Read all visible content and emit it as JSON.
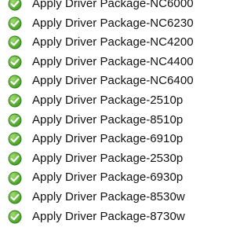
{
  "colors": {
    "check_fill_light": "#9fdc6d",
    "check_fill_dark": "#3f9a22",
    "check_border": "#2e7d17",
    "text": "#111111",
    "background": "#ffffff"
  },
  "task_list": {
    "icon": "check-circle-icon",
    "items": [
      {
        "label": "Apply Driver Package-NC6000",
        "status": "complete"
      },
      {
        "label": "Apply Driver Package-NC6230",
        "status": "complete"
      },
      {
        "label": "Apply Driver Package-NC4200",
        "status": "complete"
      },
      {
        "label": "Apply Driver Package-NC4400",
        "status": "complete"
      },
      {
        "label": "Apply Driver Package-NC6400",
        "status": "complete"
      },
      {
        "label": "Apply Driver Package-2510p",
        "status": "complete"
      },
      {
        "label": "Apply Driver Package-8510p",
        "status": "complete"
      },
      {
        "label": "Apply Driver Package-6910p",
        "status": "complete"
      },
      {
        "label": "Apply Driver Package-2530p",
        "status": "complete"
      },
      {
        "label": "Apply Driver Package-6930p",
        "status": "complete"
      },
      {
        "label": "Apply Driver Package-8530w",
        "status": "complete"
      },
      {
        "label": "Apply Driver Package-8730w",
        "status": "complete"
      }
    ]
  }
}
